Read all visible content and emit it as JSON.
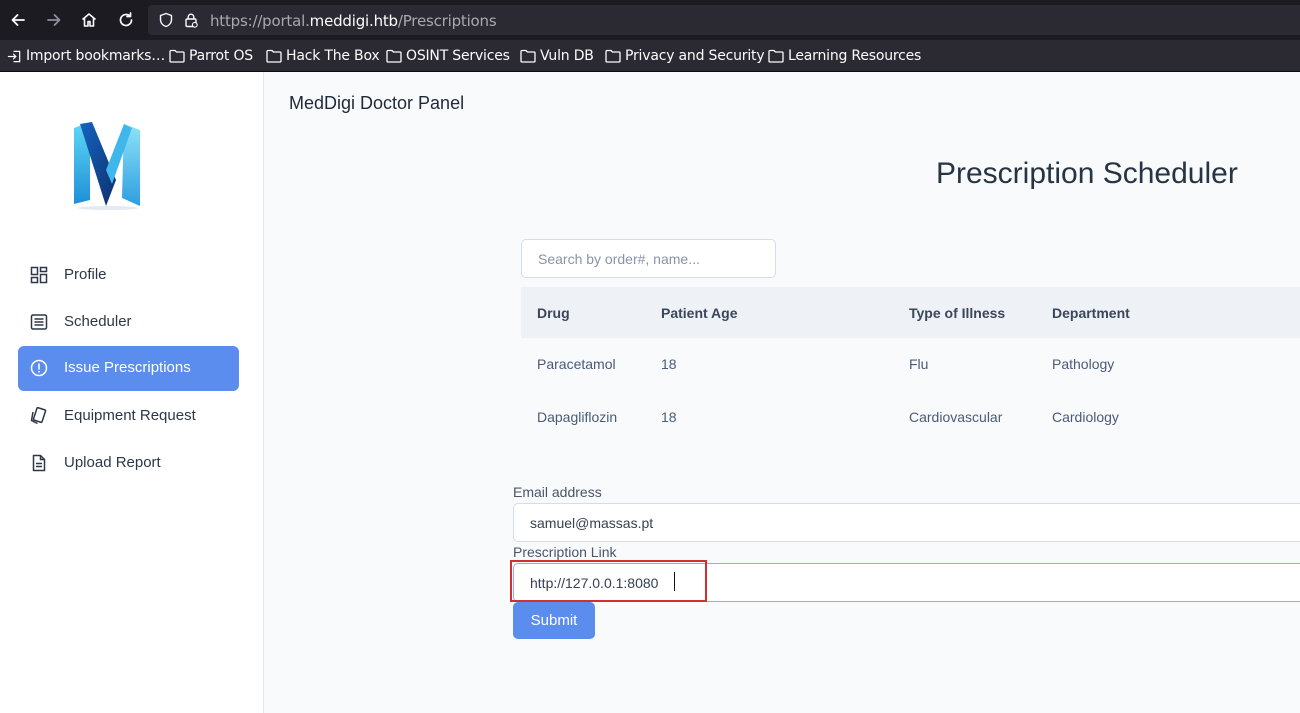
{
  "browser": {
    "url_prefix": "https://portal.",
    "url_host": "meddigi.htb",
    "url_path": "/Prescriptions",
    "bookmarks": [
      {
        "label": "Import bookmarks…",
        "icon": "import-icon"
      },
      {
        "label": "Parrot OS",
        "icon": "folder-icon"
      },
      {
        "label": "Hack The Box",
        "icon": "folder-icon"
      },
      {
        "label": "OSINT Services",
        "icon": "folder-icon"
      },
      {
        "label": "Vuln DB",
        "icon": "folder-icon"
      },
      {
        "label": "Privacy and Security",
        "icon": "folder-icon"
      },
      {
        "label": "Learning Resources",
        "icon": "folder-icon"
      }
    ]
  },
  "sidebar": {
    "logo_icon": "meddigi-m-logo",
    "items": [
      {
        "label": "Profile",
        "icon": "dashboard-grid-icon",
        "active": false
      },
      {
        "label": "Scheduler",
        "icon": "list-icon",
        "active": false
      },
      {
        "label": "Issue Prescriptions",
        "icon": "alert-circle-icon",
        "active": true
      },
      {
        "label": "Equipment Request",
        "icon": "cards-icon",
        "active": false
      },
      {
        "label": "Upload Report",
        "icon": "document-icon",
        "active": false
      }
    ]
  },
  "header": {
    "panel_title": "MedDigi Doctor Panel"
  },
  "main": {
    "heading": "Prescription Scheduler",
    "search_placeholder": "Search by order#, name...",
    "table": {
      "columns": [
        "Drug",
        "Patient Age",
        "Type of Illness",
        "Department"
      ],
      "rows": [
        [
          "Paracetamol",
          "18",
          "Flu",
          "Pathology"
        ],
        [
          "Dapagliflozin",
          "18",
          "Cardiovascular",
          "Cardiology"
        ]
      ]
    },
    "form": {
      "email_label": "Email address",
      "email_value": "samuel@massas.pt",
      "link_label": "Prescription Link",
      "link_value": "http://127.0.0.1:8080",
      "submit_label": "Submit"
    }
  },
  "colors": {
    "accent": "#5b8def",
    "annotation_box": "#d32f2f"
  }
}
